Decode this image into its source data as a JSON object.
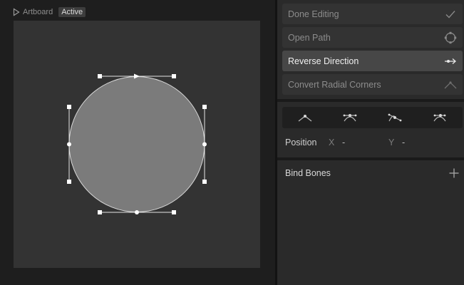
{
  "canvas": {
    "artboard_label": "Artboard",
    "artboard_status": "Active"
  },
  "actions": [
    {
      "label": "Done Editing",
      "icon": "checkmark-icon"
    },
    {
      "label": "Open Path",
      "icon": "open-path-icon"
    },
    {
      "label": "Reverse Direction",
      "icon": "reverse-direction-icon"
    },
    {
      "label": "Convert Radial Corners",
      "icon": "radial-corner-icon"
    }
  ],
  "vertex_types": [
    "straight-vertex-icon",
    "mirrored-vertex-icon",
    "detached-vertex-icon",
    "asymmetric-vertex-icon"
  ],
  "position": {
    "label": "Position",
    "x_label": "X",
    "x_value": "-",
    "y_label": "Y",
    "y_value": "-"
  },
  "bones": {
    "title": "Bind Bones"
  },
  "colors": {
    "accent_active": "#474747",
    "canvas_bg": "#333333",
    "shape_fill": "#7b7b7b"
  }
}
